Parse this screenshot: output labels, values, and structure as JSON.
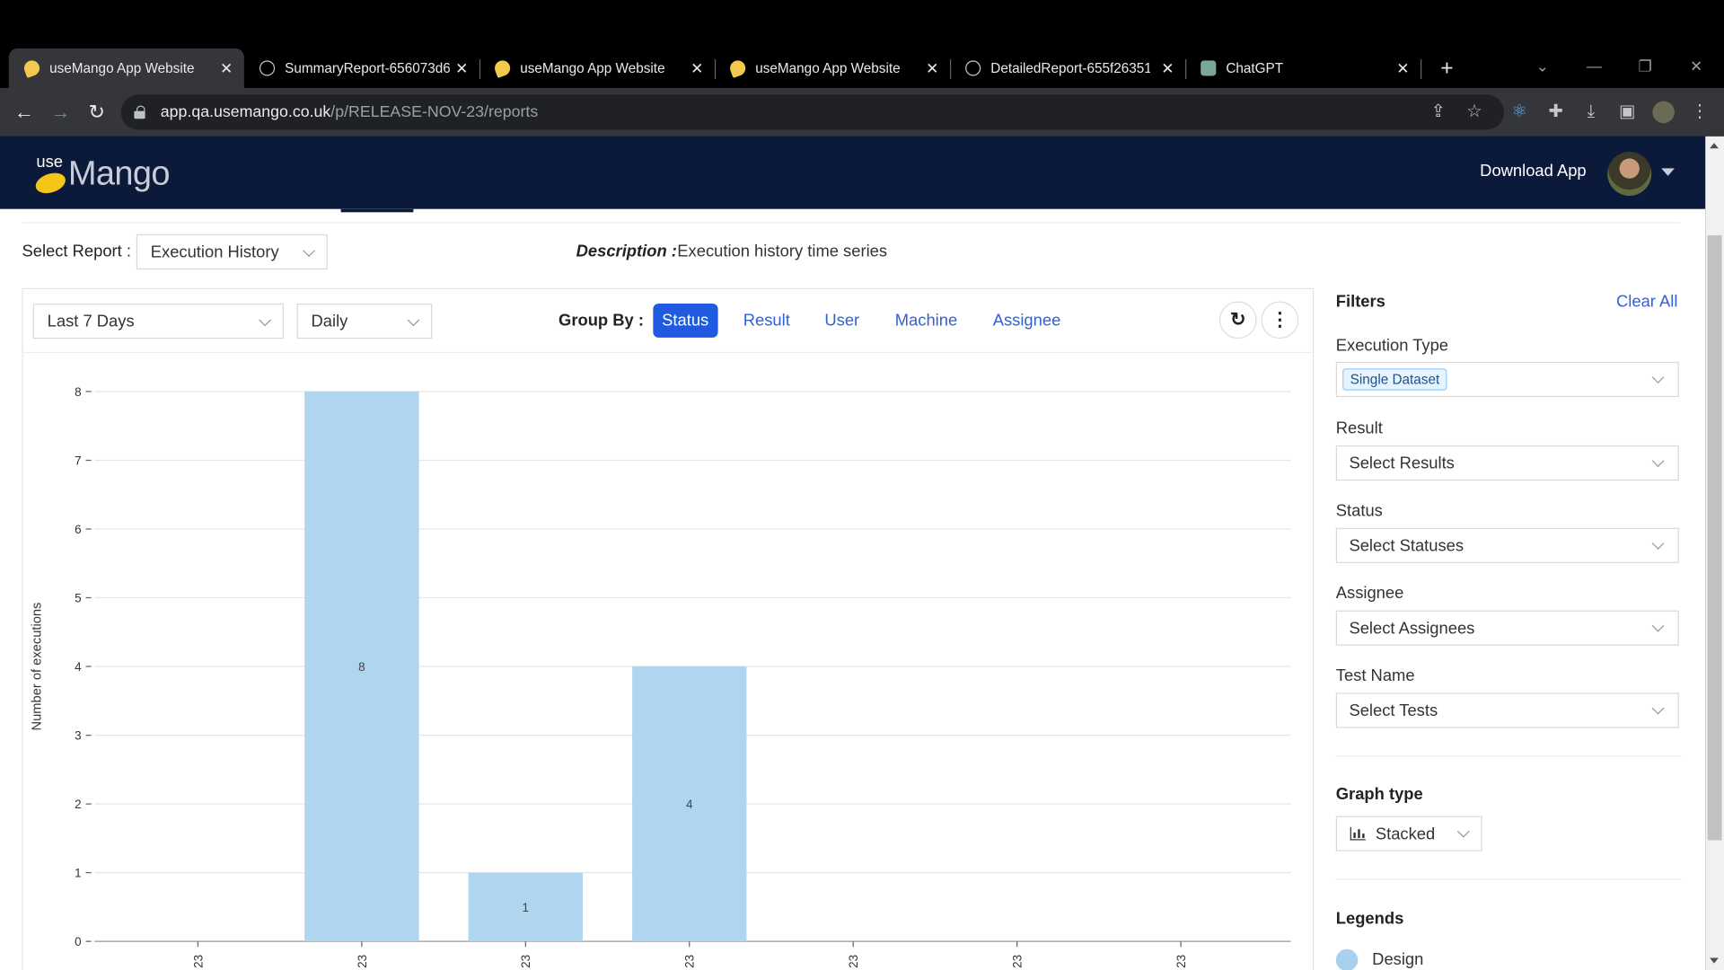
{
  "browser": {
    "tabs": [
      {
        "title": "useMango App Website",
        "icon": "mango-icon",
        "active": true
      },
      {
        "title": "SummaryReport-656073d6",
        "icon": "globe-icon",
        "active": false
      },
      {
        "title": "useMango App Website",
        "icon": "mango-icon",
        "active": false
      },
      {
        "title": "useMango App Website",
        "icon": "mango-icon",
        "active": false
      },
      {
        "title": "DetailedReport-655f26351",
        "icon": "globe-icon",
        "active": false
      },
      {
        "title": "ChatGPT",
        "icon": "chatgpt-icon",
        "active": false
      }
    ],
    "url_host": "app.qa.usemango.co.uk",
    "url_path": "/p/RELEASE-NOV-23/reports"
  },
  "app": {
    "logo_use": "use",
    "logo_mango": "Mango",
    "download_label": "Download App"
  },
  "report": {
    "select_label": "Select Report :",
    "selected": "Execution History",
    "description_key": "Description :",
    "description": "Execution history time series"
  },
  "controls": {
    "range": "Last 7 Days",
    "interval": "Daily",
    "group_by_label": "Group By :",
    "group_by": [
      "Status",
      "Result",
      "User",
      "Machine",
      "Assignee"
    ],
    "group_by_active": "Status"
  },
  "filters": {
    "title": "Filters",
    "clear_all": "Clear All",
    "execution_type_label": "Execution Type",
    "execution_type_chip": "Single Dataset",
    "result_label": "Result",
    "result_placeholder": "Select Results",
    "status_label": "Status",
    "status_placeholder": "Select Statuses",
    "assignee_label": "Assignee",
    "assignee_placeholder": "Select Assignees",
    "test_name_label": "Test Name",
    "test_name_placeholder": "Select Tests",
    "graph_type_label": "Graph type",
    "graph_type": "Stacked",
    "legends_label": "Legends",
    "legend_items": [
      {
        "name": "Design",
        "color": "#a8d1ef"
      }
    ]
  },
  "chart_data": {
    "type": "bar",
    "ylabel": "Number of executions",
    "ylim": [
      0,
      8
    ],
    "yticks": [
      0,
      1,
      2,
      3,
      4,
      5,
      6,
      7,
      8
    ],
    "categories": [
      "23",
      "23",
      "23",
      "23",
      "23",
      "23",
      "23"
    ],
    "series": [
      {
        "name": "Design",
        "values": [
          0,
          8,
          1,
          4,
          0,
          0,
          0
        ],
        "color": "#b0d5ee"
      }
    ],
    "grid": true
  }
}
